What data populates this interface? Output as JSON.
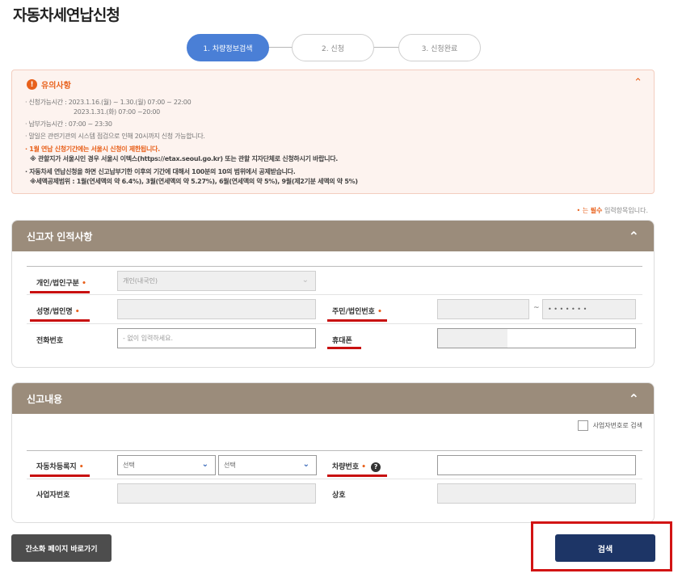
{
  "page": {
    "title": "자동차세연납신청"
  },
  "stepper": {
    "steps": [
      "1. 차량정보검색",
      "2. 신청",
      "3. 신청완료"
    ],
    "active_index": 0,
    "active_color": "#4a7fd6"
  },
  "notice": {
    "title": "유의사항",
    "toggle_icon": "chevron-up-icon",
    "lines": [
      "· 신청가능시간 : 2023.1.16.(월) ~ 1.30.(월) 07:00 ~ 22:00",
      "2023.1.31.(화) 07:00 ~20:00",
      "· 납부가능시간 : 07:00 ~ 23:30",
      "· 말일은 관련기관의 시스템 점검으로 인해 20시까지 신청 가능합니다.",
      "· 1월 연납 신청기간에는 서울시 신청이 제한됩니다.",
      "※ 관할지가 서울시인 경우 서울시 이텍스(https://etax.seoul.go.kr) 또는 관할 지자단체로 신청하시기 바랍니다.",
      "· 자동차세 연납신청을 하면 신고납부기한 이후의 기간에 대해서 100분의 10의 범위에서 공제받습니다.",
      "※세액공제범위 : 1월(연세액의 약 6.4%), 3월(연세액의 약 5.27%), 6월(연세액의 약 5%), 9월(제2기분 세액의 약 5%)"
    ],
    "accent_color": "#e8611c"
  },
  "required_note": {
    "prefix": "• 는",
    "emphasis": "필수",
    "suffix": "입력항목입니다."
  },
  "reporter_section": {
    "title": "신고자 인적사항",
    "type_label": "개인/법인구분",
    "type_value": "개인(내국인)",
    "name_label": "성명/법인명",
    "name_value": "",
    "id_label": "주민/법인번호",
    "id_front": "",
    "id_separator": "~",
    "id_back_masked": "• • • • • • •",
    "phone_label": "전화번호",
    "phone_placeholder": "- 없이 입력하세요.",
    "mobile_label": "휴대폰",
    "mobile_value": ""
  },
  "report_section": {
    "title": "신고내용",
    "biz_search_label": "사업자번호로 검색",
    "registration_label": "자동차등록지",
    "select1_value": "선택",
    "select2_value": "선택",
    "plate_label": "차량번호",
    "plate_value": "",
    "biz_number_label": "사업자번호",
    "biz_number_value": "",
    "company_label": "상호",
    "company_value": ""
  },
  "buttons": {
    "simple_page": "간소화 페이지 바로가기",
    "search": "검색"
  },
  "colors": {
    "panel_header": "#9b8c7b",
    "search_button": "#1d3566",
    "highlight": "#d21414"
  }
}
